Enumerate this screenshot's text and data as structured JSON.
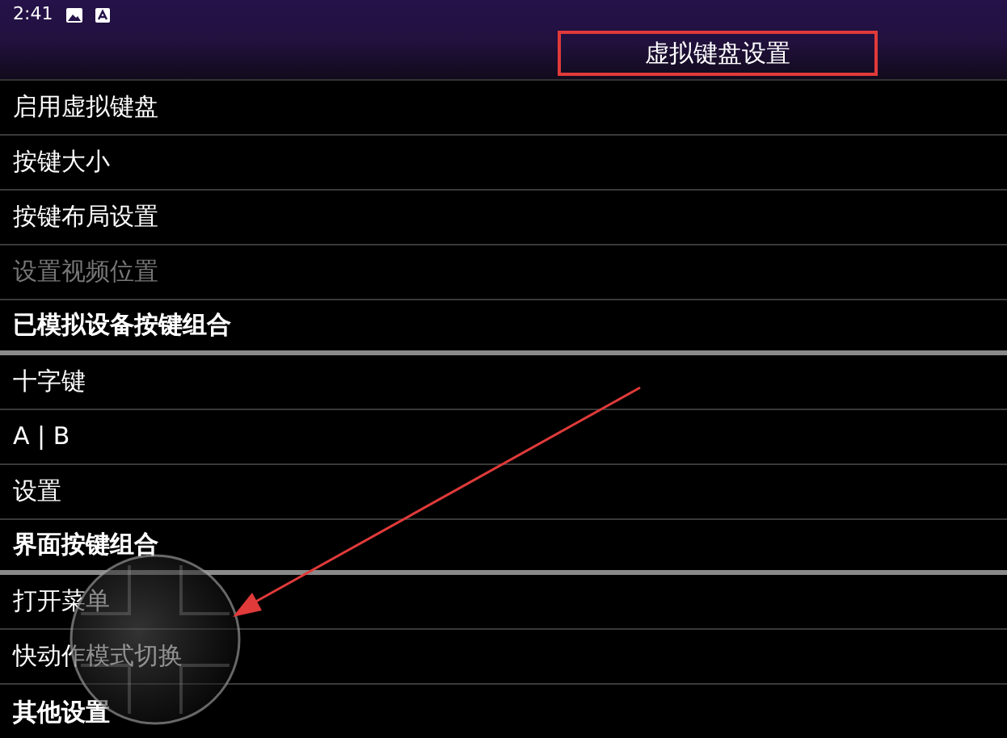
{
  "status_bar": {
    "time": "2:41"
  },
  "title": "虚拟键盘设置",
  "rows": [
    {
      "label": "启用虚拟键盘",
      "kind": "item",
      "disabled": false
    },
    {
      "label": "按键大小",
      "kind": "item",
      "disabled": false
    },
    {
      "label": "按键布局设置",
      "kind": "item",
      "disabled": false
    },
    {
      "label": "设置视频位置",
      "kind": "item",
      "disabled": true
    },
    {
      "label": "已模拟设备按键组合",
      "kind": "section",
      "disabled": false
    },
    {
      "label": "十字键",
      "kind": "item",
      "disabled": false
    },
    {
      "label": "A | B",
      "kind": "item",
      "disabled": false
    },
    {
      "label": "设置",
      "kind": "item",
      "disabled": false
    },
    {
      "label": "界面按键组合",
      "kind": "section",
      "disabled": false
    },
    {
      "label": "打开菜单",
      "kind": "item",
      "disabled": false
    },
    {
      "label": "快动作模式切换",
      "kind": "item",
      "disabled": false
    },
    {
      "label": "其他设置",
      "kind": "section",
      "disabled": false
    }
  ]
}
